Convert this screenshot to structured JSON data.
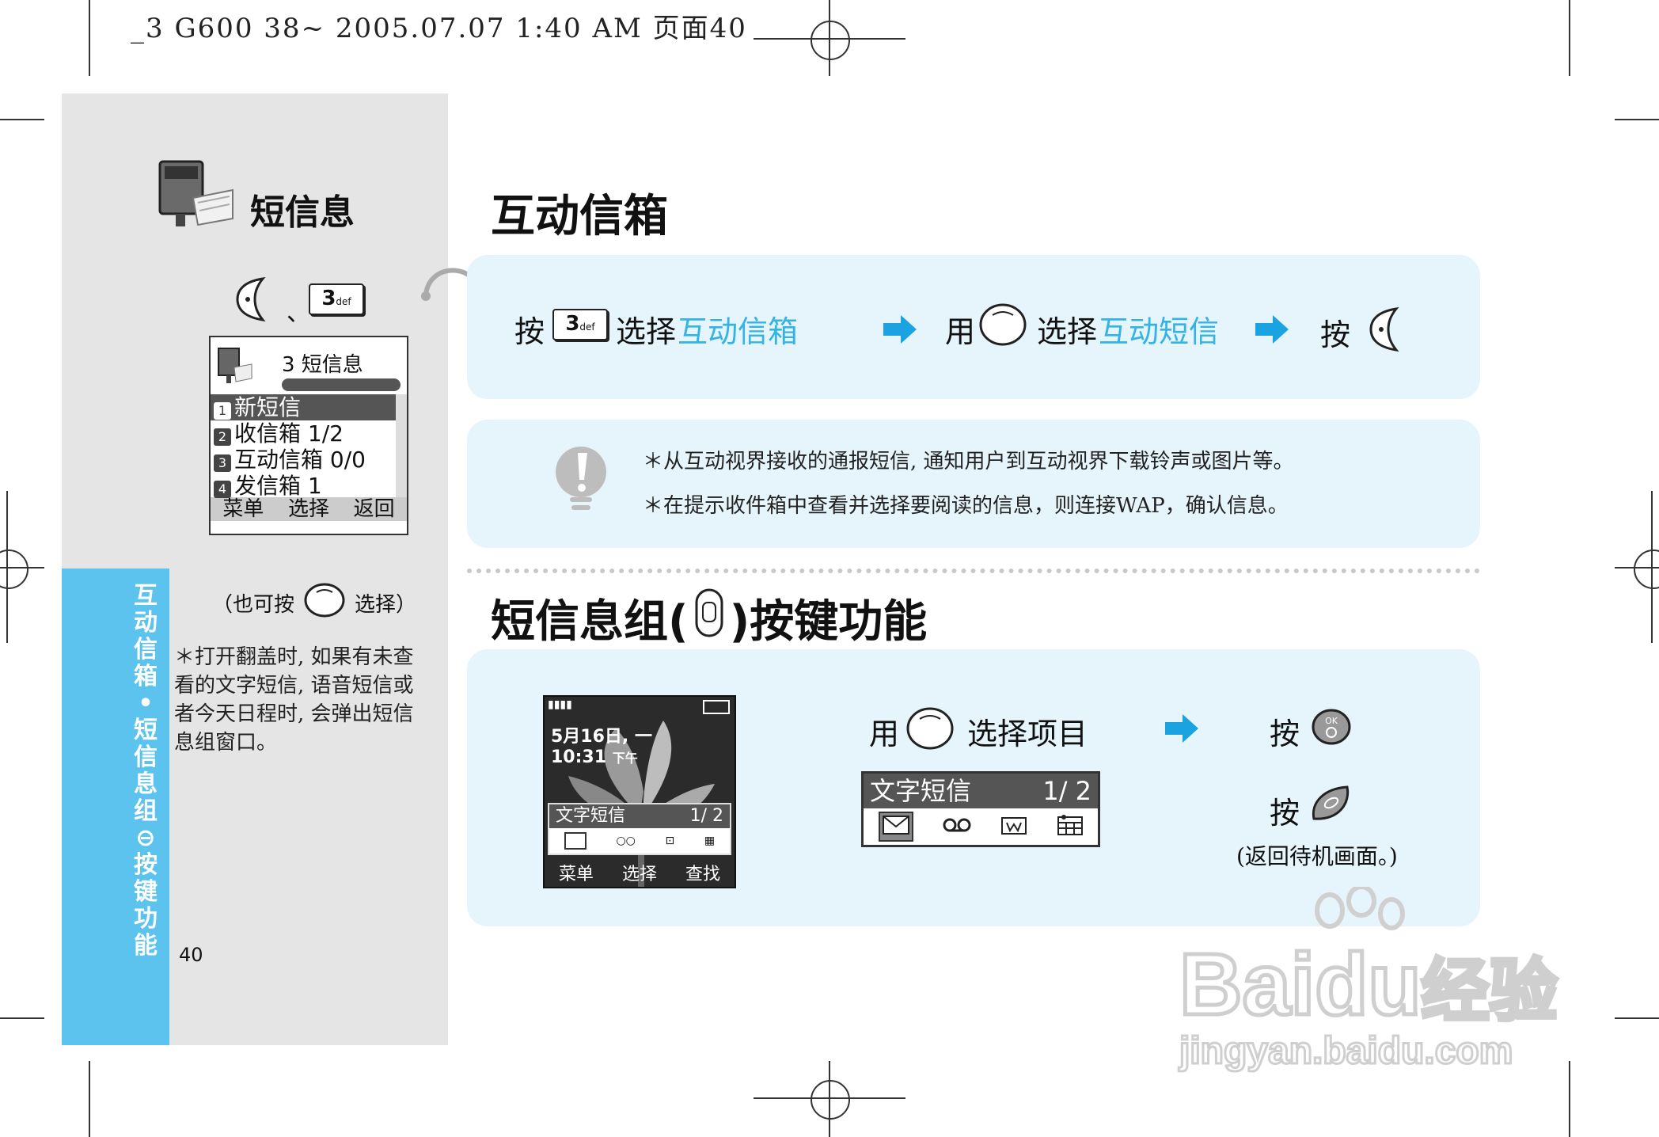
{
  "header": {
    "print_line": "_3 G600 38~ 2005.07.07 1:40 AM 页面40"
  },
  "sidebar": {
    "section_title": "短信息",
    "key_separator": "、",
    "key3": {
      "digit": "3",
      "sub": "def"
    },
    "phone_menu": {
      "header_title": "3 短信息",
      "items": [
        {
          "num": "1",
          "label": "新短信",
          "selected": true
        },
        {
          "num": "2",
          "label": "收信箱 1/2",
          "selected": false
        },
        {
          "num": "3",
          "label": "互动信箱 0/0",
          "selected": false
        },
        {
          "num": "4",
          "label": "发信箱 1",
          "selected": false
        }
      ],
      "softkeys": [
        "菜单",
        "选择",
        "返回"
      ]
    },
    "also_press_before": "（也可按",
    "also_press_after": "选择）",
    "footnote": "＊打开翻盖时, 如果有未查看的文字短信, 语音短信或者今天日程时, 会弹出短信息组窗口。",
    "vertical_label": [
      "互",
      "动",
      "信",
      "箱",
      "•",
      "短",
      "信",
      "息",
      "组",
      "⊖",
      "按",
      "键",
      "功",
      "能"
    ],
    "page_number": "40"
  },
  "section1": {
    "title": "互动信箱",
    "steps": {
      "press": "按",
      "select": "选择",
      "target1": "互动信箱",
      "use": "用",
      "target2": "互动短信",
      "press_final": "按"
    },
    "notes": [
      "＊从互动视界接收的通报短信, 通知用户到互动视界下载铃声或图片等。",
      "＊在提示收件箱中查看并选择要阅读的信息，则连接WAP，确认信息。"
    ]
  },
  "section2": {
    "title_before": "短信息组(",
    "title_after": ")按键功能",
    "phone_standby": {
      "date": "5月16日, 一",
      "time": "10:31",
      "ampm": "下午",
      "popup_label": "文字短信",
      "popup_count": "1/ 2",
      "softkeys": [
        "菜单",
        "选择",
        "查找"
      ]
    },
    "use": "用",
    "select_item": "选择项目",
    "popup": {
      "label": "文字短信",
      "count": "1/ 2"
    },
    "press_ok": "按",
    "press_end": "按",
    "return_note": "(返回待机画面。)"
  },
  "watermark": {
    "brand": "Bai",
    "brand2": "du",
    "cn": "经验",
    "url": "jingyan.baidu.com"
  },
  "colors": {
    "accent": "#34b3e6",
    "panel": "#e6f5fc",
    "sidestrip": "#5cc3ef",
    "leftpanel": "#e5e5e5"
  }
}
